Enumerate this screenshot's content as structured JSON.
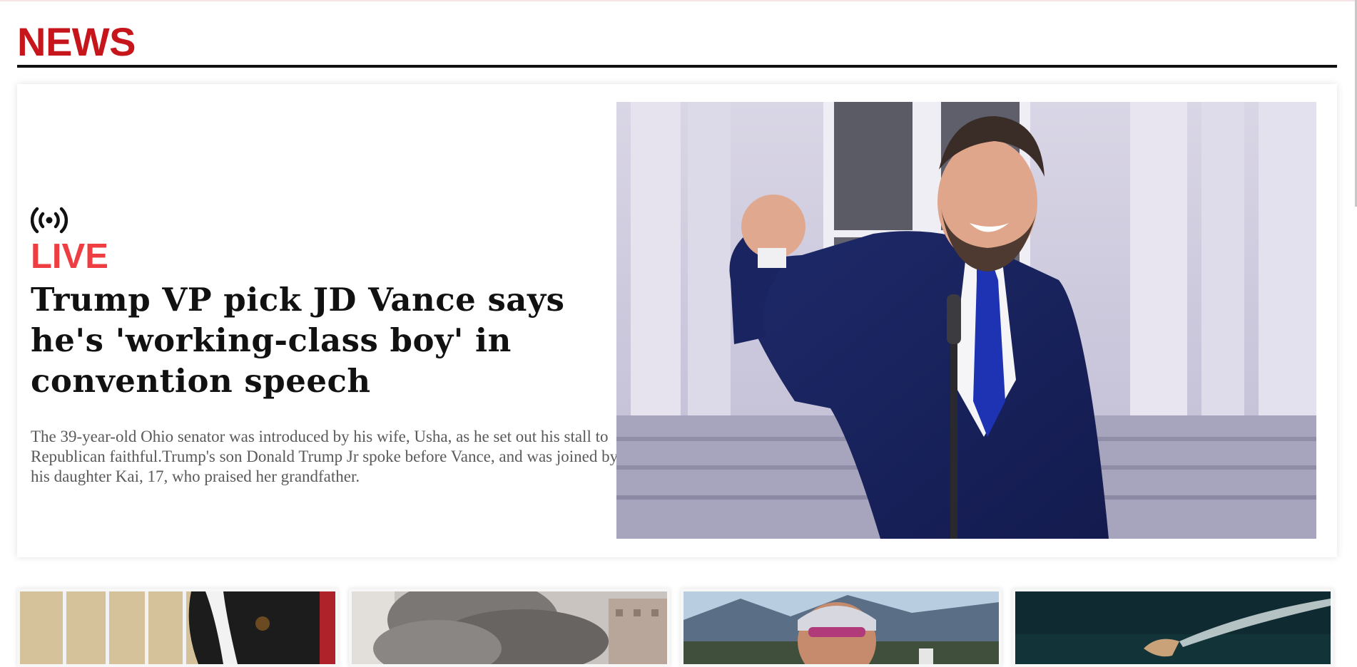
{
  "section": {
    "title": "NEWS"
  },
  "feature": {
    "live_icon": "broadcast-icon",
    "live_label": "LIVE",
    "headline": "Trump VP pick JD Vance says he's 'working-class boy' in convention speech",
    "summary": "The 39-year-old Ohio senator was introduced by his wife, Usha, as he set out his stall to Republican faithful.Trump's son Donald Trump Jr spoke before Vance, and was joined by his daughter Kai, 17, who praised her grandfather.",
    "image": "speaker-at-podium-photo"
  },
  "thumbnails": [
    {
      "image": "dog-in-cage-photo"
    },
    {
      "image": "smoke-over-city-photo"
    },
    {
      "image": "cyclist-portrait-photo"
    },
    {
      "image": "water-jet-photo"
    }
  ],
  "colors": {
    "brand_red": "#c6161c",
    "live_red": "#ef3e42",
    "headline": "#111111",
    "summary": "#5a5a5a"
  }
}
